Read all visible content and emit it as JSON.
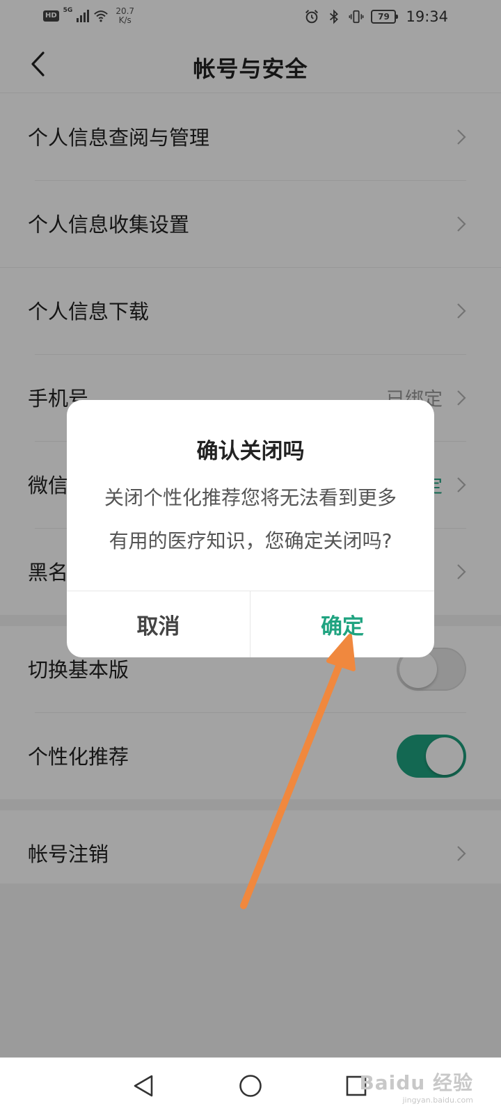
{
  "status_bar": {
    "hd": "HD",
    "network": "5G",
    "speed_value": "20.7",
    "speed_unit": "K/s",
    "battery": "79",
    "time": "19:34"
  },
  "header": {
    "title": "帐号与安全"
  },
  "list": {
    "items": [
      {
        "label": "个人信息查阅与管理"
      },
      {
        "label": "个人信息收集设置"
      },
      {
        "label": "个人信息下载"
      },
      {
        "label": "手机号",
        "value": "已绑定"
      },
      {
        "label": "微信",
        "value": "定"
      },
      {
        "label": "黑名"
      },
      {
        "label": "切换基本版",
        "toggle": false
      },
      {
        "label": "个性化推荐",
        "toggle": true
      },
      {
        "label": "帐号注销"
      }
    ]
  },
  "dialog": {
    "title": "确认关闭吗",
    "message": "关闭个性化推荐您将无法看到更多有用的医疗知识，您确定关闭吗?",
    "cancel": "取消",
    "confirm": "确定"
  },
  "watermark": {
    "brand": "Baidu 经验",
    "url": "jingyan.baidu.com"
  },
  "colors": {
    "accent": "#1fa380",
    "annotation_arrow": "#f0883e"
  },
  "icons": [
    "back-arrow-icon",
    "chevron-right-icon",
    "alarm-icon",
    "bluetooth-icon",
    "vibrate-icon",
    "wifi-icon",
    "nav-back-icon",
    "nav-home-icon",
    "nav-recents-icon"
  ]
}
